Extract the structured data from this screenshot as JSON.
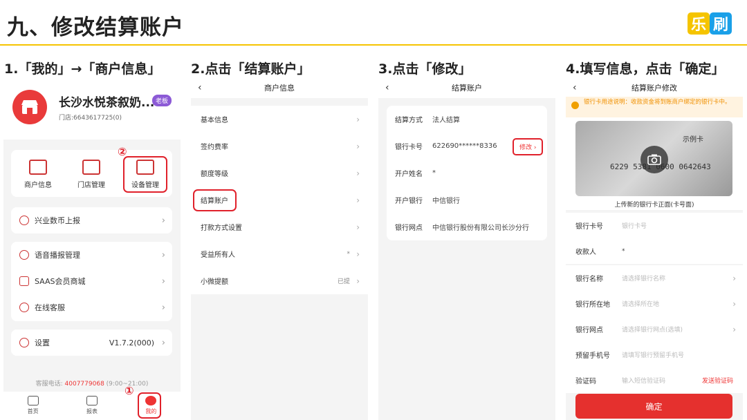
{
  "title": "九、修改结算账户",
  "logo": {
    "char1": "乐",
    "char2": "刷",
    "color1": "#f5c400",
    "color2": "#1aa0e8"
  },
  "steps": [
    "1.「我的」→「商户信息」",
    "2.点击「结算账户」",
    "3.点击「修改」",
    "4.填写信息，点击「确定」"
  ],
  "panel1": {
    "store_name": "长沙水悦茶叙奶...",
    "badge": "老板",
    "store_id": "门店:6643617725(0)",
    "grid": [
      "商户信息",
      "门店管理",
      "设备管理"
    ],
    "menu1": [
      "兴业数币上报"
    ],
    "menu2": [
      "语音播报管理",
      "SAAS会员商城",
      "在线客服"
    ],
    "settings": {
      "label": "设置",
      "value": "V1.7.2(000)"
    },
    "hotline_label": "客服电话:",
    "hotline_number": "4007779068",
    "hotline_hours": "(9:00~21:00)",
    "tabs": [
      "首页",
      "报表",
      "我的"
    ],
    "markers": [
      "②",
      "①"
    ]
  },
  "panel2": {
    "nav_title": "商户信息",
    "items": [
      "基本信息",
      "签约费率",
      "额度等级",
      "结算账户",
      "打款方式设置",
      "受益所有人",
      "小微提额"
    ],
    "beneficiary_value": "*",
    "micro_value": "已提"
  },
  "panel3": {
    "nav_title": "结算账户",
    "rows": [
      {
        "k": "结算方式",
        "v": "法人结算"
      },
      {
        "k": "银行卡号",
        "v": "622690******8336"
      },
      {
        "k": "开户姓名",
        "v": "*"
      },
      {
        "k": "开户银行",
        "v": "中信银行"
      },
      {
        "k": "银行网点",
        "v": "中信银行股份有限公司长沙分行"
      }
    ],
    "edit_label": "修改"
  },
  "panel4": {
    "nav_title": "结算账户修改",
    "notice": "银行卡用途说明：收款资金将到账商户绑定的银行卡中。",
    "card_sample": "示例卡",
    "card_number": "6229 5381 0600 0642643",
    "card_caption": "上传新的银行卡正面(卡号面)",
    "fields": [
      {
        "k": "银行卡号",
        "ph": "银行卡号"
      },
      {
        "k": "收款人",
        "ph": "*"
      },
      {
        "k": "银行名称",
        "ph": "请选择银行名称"
      },
      {
        "k": "银行所在地",
        "ph": "请选择所在地"
      },
      {
        "k": "银行网点",
        "ph": "请选择银行网点(选填)"
      },
      {
        "k": "预留手机号",
        "ph": "请填写银行预留手机号"
      },
      {
        "k": "验证码",
        "ph": "输入短信验证码"
      }
    ],
    "send_code": "发送验证码",
    "confirm": "确定"
  }
}
